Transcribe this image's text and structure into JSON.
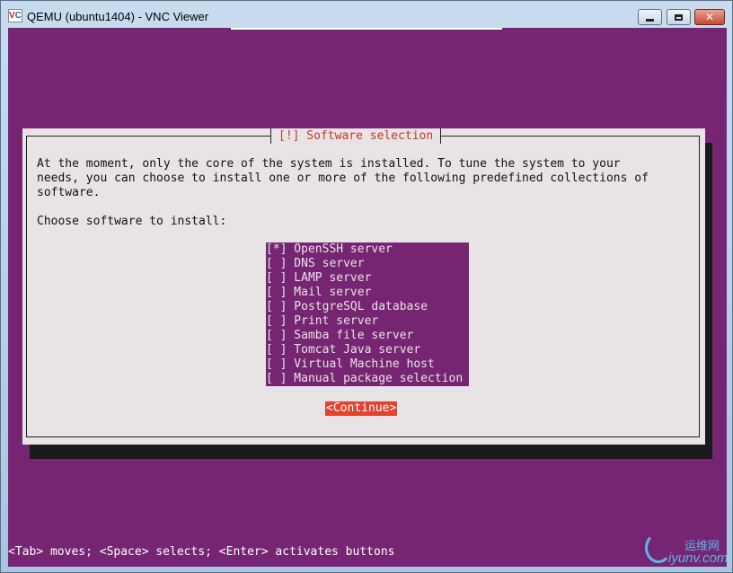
{
  "window": {
    "title": "QEMU (ubuntu1404) - VNC Viewer",
    "icon_text_v": "V",
    "icon_text_c": "C"
  },
  "dialog": {
    "title": "[!] Software selection",
    "intro_lines": [
      "At the moment, only the core of the system is installed. To tune the system to your",
      "needs, you can choose to install one or more of the following predefined collections of",
      "software."
    ],
    "prompt": "Choose software to install:",
    "items": [
      {
        "label": "[*] OpenSSH server"
      },
      {
        "label": "[ ] DNS server"
      },
      {
        "label": "[ ] LAMP server"
      },
      {
        "label": "[ ] Mail server"
      },
      {
        "label": "[ ] PostgreSQL database"
      },
      {
        "label": "[ ] Print server"
      },
      {
        "label": "[ ] Samba file server"
      },
      {
        "label": "[ ] Tomcat Java server"
      },
      {
        "label": "[ ] Virtual Machine host"
      },
      {
        "label": "[ ] Manual package selection"
      }
    ],
    "continue_label": "<Continue>"
  },
  "statusbar": {
    "text": "<Tab> moves; <Space> selects; <Enter> activates buttons"
  },
  "watermark": {
    "cn": "运维网",
    "en": "iyunv.com"
  },
  "colors": {
    "screen_bg": "#762572",
    "dialog_bg": "#e8e4e6",
    "title_red": "#c4362a",
    "button_red": "#e0432f"
  }
}
